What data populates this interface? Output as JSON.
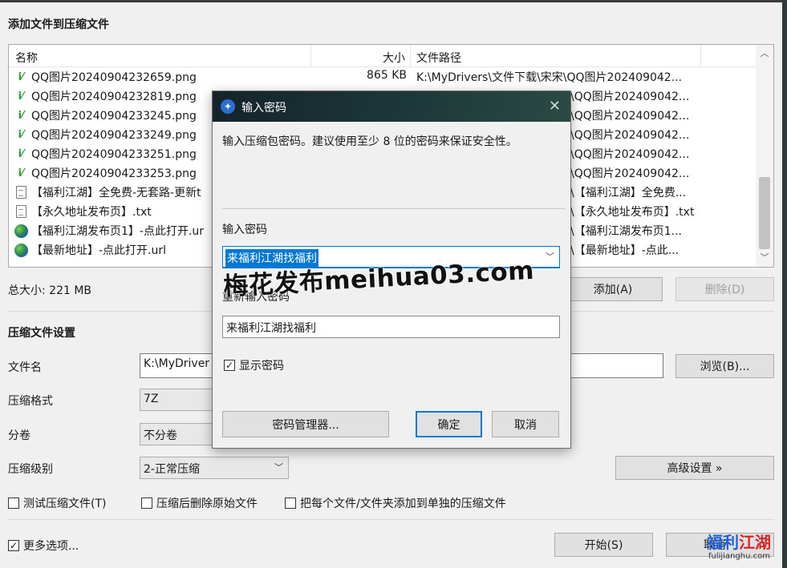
{
  "main": {
    "title": "添加文件到压缩文件",
    "columns": {
      "name": "名称",
      "size": "大小",
      "path": "文件路径"
    },
    "files": [
      {
        "icon": "png-icon",
        "name": "QQ图片20240904232659.png",
        "size": "865 KB",
        "path": "K:\\MyDrivers\\文件下载\\宋宋\\QQ图片202409042..."
      },
      {
        "icon": "png-icon",
        "name": "QQ图片20240904232819.png",
        "size": "",
        "path": "\\QQ图片202409042..."
      },
      {
        "icon": "png-icon",
        "name": "QQ图片20240904233245.png",
        "size": "",
        "path": "\\QQ图片202409042..."
      },
      {
        "icon": "png-icon",
        "name": "QQ图片20240904233249.png",
        "size": "",
        "path": "\\QQ图片202409042..."
      },
      {
        "icon": "png-icon",
        "name": "QQ图片20240904233251.png",
        "size": "",
        "path": "\\QQ图片202409042..."
      },
      {
        "icon": "png-icon",
        "name": "QQ图片20240904233253.png",
        "size": "",
        "path": "\\QQ图片202409042..."
      },
      {
        "icon": "txt-icon",
        "name": "【福利江湖】全免费-无套路-更新t",
        "size": "",
        "path": "\\【福利江湖】全免费..."
      },
      {
        "icon": "txt-icon",
        "name": "【永久地址发布页】.txt",
        "size": "",
        "path": "\\【永久地址发布页】.txt"
      },
      {
        "icon": "url-icon",
        "name": "【福利江湖发布页1】-点此打开.ur",
        "size": "",
        "path": "\\【福利江湖发布页1..."
      },
      {
        "icon": "url-icon",
        "name": "【最新地址】-点此打开.url",
        "size": "",
        "path": "\\【最新地址】-点此..."
      }
    ],
    "total_size": "总大小: 221 MB",
    "add_button": "添加(A)",
    "delete_button": "删除(D)",
    "settings_title": "压缩文件设置",
    "filename_label": "文件名",
    "filename_value": "K:\\MyDriver",
    "browse_button": "浏览(B)...",
    "format_label": "压缩格式",
    "format_value": "7Z",
    "volume_label": "分卷",
    "volume_value": "不分卷",
    "level_label": "压缩级别",
    "level_value": "2-正常压缩",
    "advanced_button": "高级设置 »",
    "test_checkbox": "测试压缩文件(T)",
    "delete_after_checkbox": "压缩后删除原始文件",
    "each_file_checkbox": "把每个文件/文件夹添加到单独的压缩文件",
    "more_options_checkbox": "更多选项...",
    "start_button": "开始(S)",
    "cancel_button": "取消"
  },
  "dialog": {
    "title": "输入密码",
    "description": "输入压缩包密码。建议使用至少 8 位的密码来保证安全性。",
    "password_label": "输入密码",
    "password_value": "来福利江湖找福利",
    "confirm_label": "重新输入密码",
    "confirm_value": "来福利江湖找福利",
    "show_password": "显示密码",
    "manager_button": "密码管理器...",
    "ok_button": "确定",
    "cancel_button": "取消"
  },
  "watermark": "梅花发布meihua03.com",
  "corner_logo": {
    "part1": "福利",
    "part2": "江湖",
    "domain": "fulijianghu.com"
  }
}
